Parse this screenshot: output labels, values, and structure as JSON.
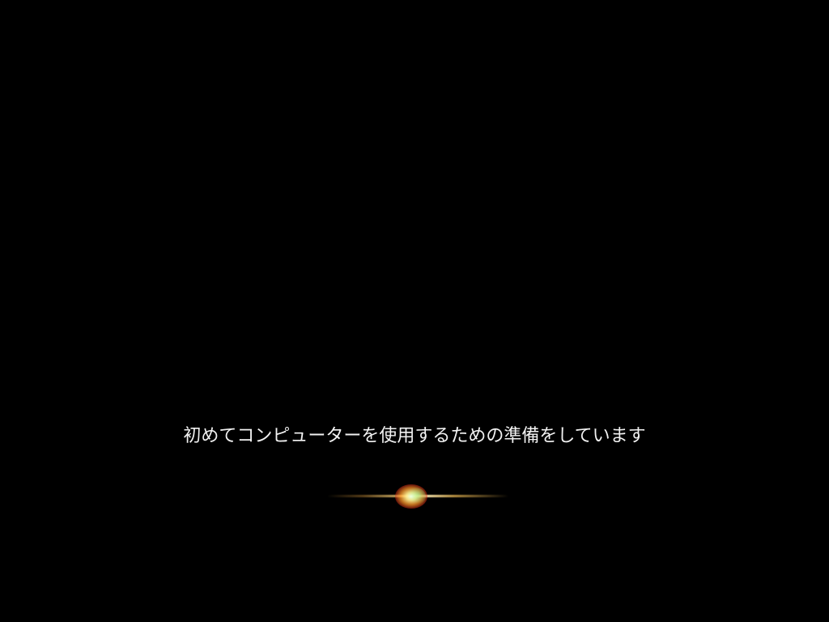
{
  "screen": {
    "background_color": "#000000",
    "message": "初めてコンピューターを使用するための準備をしています",
    "text_color": "#f2f2f2",
    "animation_icon": "boot-light-flare-icon",
    "flare_colors": [
      "#fff6d5",
      "#ffb347",
      "#d9301a",
      "#7dffb0"
    ]
  }
}
